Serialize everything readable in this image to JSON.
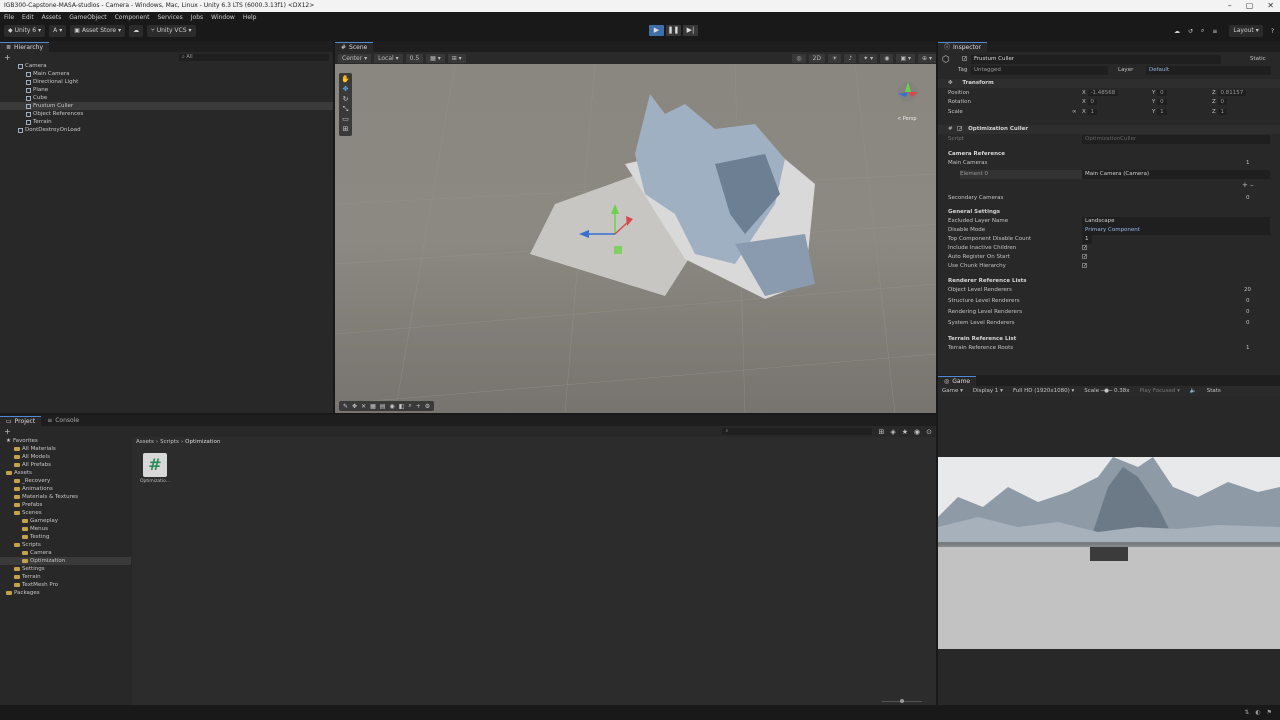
{
  "window": {
    "title": "IGB300-Capstone-MASA-studios - Camera - Windows, Mac, Linux - Unity 6.3 LTS (6000.3.13f1) <DX12>"
  },
  "menu": [
    "File",
    "Edit",
    "Assets",
    "GameObject",
    "Component",
    "Services",
    "Jobs",
    "Window",
    "Help"
  ],
  "toolbar": {
    "unity_label": "Unity 6",
    "account_label": "A",
    "asset_store_label": "Asset Store",
    "vcs_label": "Unity VCS",
    "layout_label": "Layout"
  },
  "hierarchy": {
    "tab": "Hierarchy",
    "search_placeholder": "All",
    "items": [
      {
        "label": "Camera",
        "indent": 0
      },
      {
        "label": "Main Camera",
        "indent": 1
      },
      {
        "label": "Directional Light",
        "indent": 1
      },
      {
        "label": "Plane",
        "indent": 1
      },
      {
        "label": "Cube",
        "indent": 1
      },
      {
        "label": "Frustum Culler",
        "indent": 1
      },
      {
        "label": "Object References",
        "indent": 1
      },
      {
        "label": "Terrain",
        "indent": 1
      },
      {
        "label": "DontDestroyOnLoad",
        "indent": 0
      }
    ]
  },
  "scene": {
    "tab": "Scene",
    "pivot_label": "Center",
    "space_label": "Local",
    "snap_value": "0.5",
    "persp_label": "< Persp"
  },
  "inspector": {
    "tab": "Inspector",
    "object_name": "Frustum Culler",
    "static_label": "Static",
    "tag_label": "Tag",
    "tag_value": "Untagged",
    "layer_label": "Layer",
    "layer_value": "Default",
    "transform": {
      "title": "Transform",
      "position_label": "Position",
      "rotation_label": "Rotation",
      "scale_label": "Scale",
      "position": {
        "x": "-1.48568",
        "y": "0",
        "z": "0.81157"
      },
      "rotation": {
        "x": "0",
        "y": "0",
        "z": "0"
      },
      "scale": {
        "x": "1",
        "y": "1",
        "z": "1"
      }
    },
    "component": {
      "title": "Optimization Culler",
      "script_label": "Script",
      "script_value": "OptimizationCuller",
      "camera_reference": "Camera Reference",
      "main_cameras": "Main Cameras",
      "main_cameras_count": "1",
      "element0": "Element 0",
      "element0_value": "Main Camera (Camera)",
      "secondary_cameras": "Secondary Cameras",
      "secondary_count": "0",
      "general_settings": "General Settings",
      "excluded_layer_label": "Excluded Layer Name",
      "excluded_layer_value": "Landscape",
      "disable_mode_label": "Disable Mode",
      "disable_mode_value": "Primary Component",
      "top_component_label": "Top Component Disable Count",
      "top_component_value": "1",
      "include_inactive_label": "Include Inactive Children",
      "auto_register_label": "Auto Register On Start",
      "use_chunk_label": "Use Chunk Hierarchy",
      "renderer_lists": "Renderer Reference Lists",
      "object_level": "Object Level Renderers",
      "object_level_count": "20",
      "structure_level": "Structure Level Renderers",
      "structure_level_count": "0",
      "rendering_level": "Rendering Level Renderers",
      "rendering_level_count": "0",
      "system_level": "System Level Renderers",
      "system_level_count": "0",
      "terrain_list": "Terrain Reference List",
      "terrain_roots": "Terrain Reference Roots",
      "terrain_roots_count": "1"
    }
  },
  "game": {
    "tab": "Game",
    "mode_label": "Game",
    "display_label": "Display 1",
    "resolution_label": "Full HD (1920x1080)",
    "scale_label": "Scale",
    "scale_value": "0.38x",
    "play_focused_label": "Play Focused",
    "stats_label": "Stats"
  },
  "project": {
    "tabs": [
      "Project",
      "Console"
    ],
    "favorites_label": "Favorites",
    "favorites": [
      "All Materials",
      "All Models",
      "All Prefabs"
    ],
    "assets_label": "Assets",
    "assets": [
      {
        "label": "_Recovery",
        "indent": 1
      },
      {
        "label": "Animations",
        "indent": 1
      },
      {
        "label": "Materials & Textures",
        "indent": 1
      },
      {
        "label": "Prefabs",
        "indent": 1
      },
      {
        "label": "Scenes",
        "indent": 1
      },
      {
        "label": "Gameplay",
        "indent": 2
      },
      {
        "label": "Menus",
        "indent": 2
      },
      {
        "label": "Testing",
        "indent": 2
      },
      {
        "label": "Scripts",
        "indent": 1
      },
      {
        "label": "Camera",
        "indent": 2
      },
      {
        "label": "Optimization",
        "indent": 2
      },
      {
        "label": "Settings",
        "indent": 1
      },
      {
        "label": "Terrain",
        "indent": 1
      },
      {
        "label": "TextMesh Pro",
        "indent": 1
      }
    ],
    "packages_label": "Packages",
    "breadcrumb": [
      "Assets",
      "Scripts",
      "Optimization"
    ],
    "file_name": "Optimizatio...",
    "slider_value": 0.5
  }
}
